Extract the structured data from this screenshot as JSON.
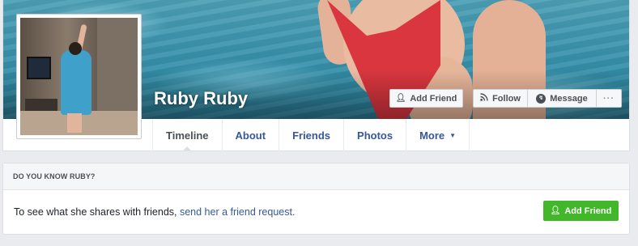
{
  "profile": {
    "name": "Ruby Ruby"
  },
  "cover_actions": {
    "add_friend": "Add Friend",
    "follow": "Follow",
    "message": "Message",
    "more": "···"
  },
  "icons": {
    "add_friend": "person-plus-icon",
    "follow": "rss-icon",
    "message": "messenger-icon",
    "more_tab": "caret-down-icon"
  },
  "tabs": [
    {
      "label": "Timeline",
      "active": true
    },
    {
      "label": "About"
    },
    {
      "label": "Friends"
    },
    {
      "label": "Photos"
    },
    {
      "label": "More"
    }
  ],
  "know_card": {
    "header": "DO YOU KNOW RUBY?",
    "text": "To see what she shares with friends, ",
    "link": "send her a friend request.",
    "button": "Add Friend"
  },
  "colors": {
    "link": "#365899",
    "green_button": "#42b72a",
    "page_bg": "#e9ebee"
  }
}
